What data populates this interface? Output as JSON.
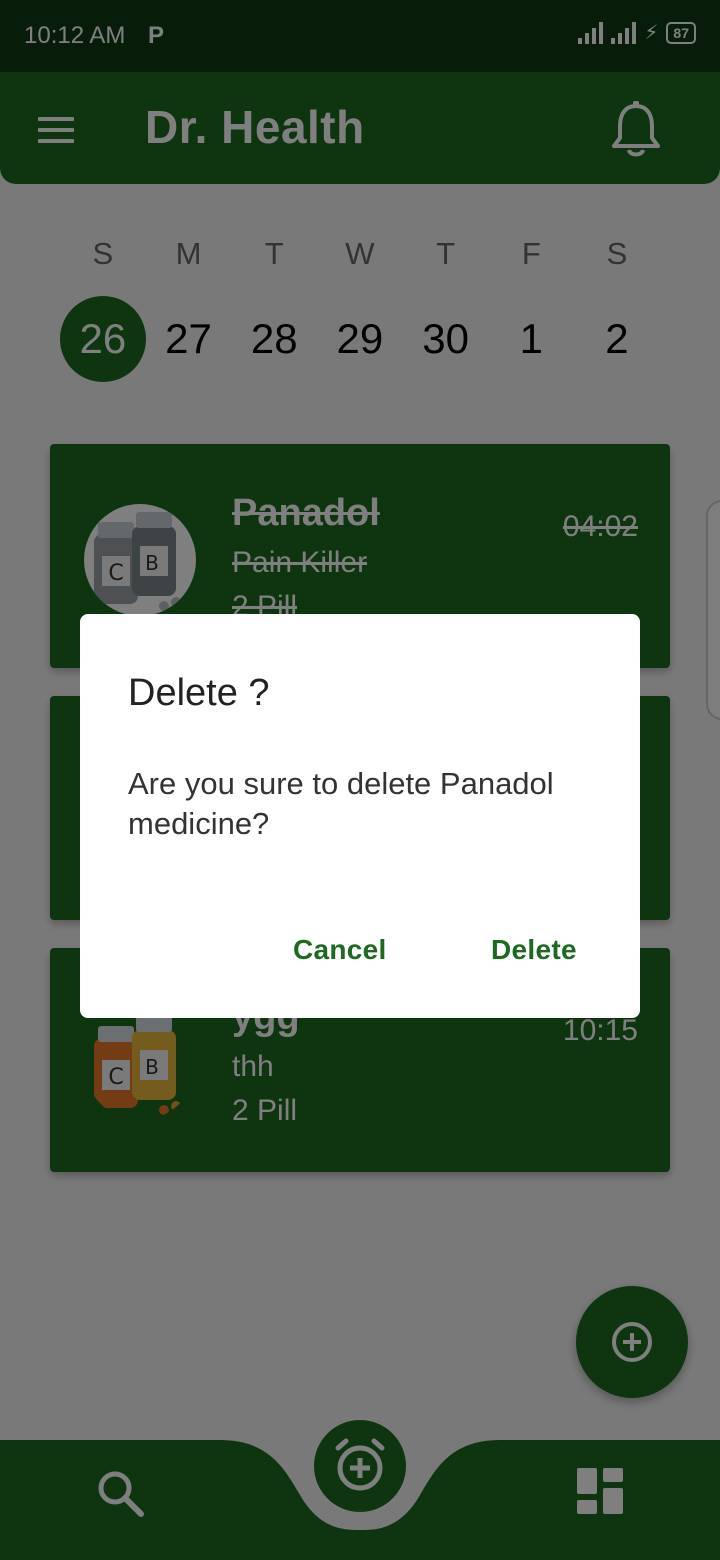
{
  "status": {
    "time": "10:12 AM",
    "p_icon": "P",
    "battery": "87"
  },
  "app": {
    "title": "Dr. Health",
    "menu_icon": "hamburger-menu-icon",
    "bell_icon": "bell-icon"
  },
  "calendar": {
    "weekdays": [
      "S",
      "M",
      "T",
      "W",
      "T",
      "F",
      "S"
    ],
    "dates": [
      "26",
      "27",
      "28",
      "29",
      "30",
      "1",
      "2"
    ],
    "selected_index": 0
  },
  "medicines": [
    {
      "name": "Panadol",
      "type": "Pain Killer",
      "dose": "2 Pill",
      "time": "04:02",
      "taken": true
    },
    {
      "name": "",
      "type": "",
      "dose": "",
      "time": ""
    },
    {
      "name": "ygg",
      "type": "thh",
      "dose": "2 Pill",
      "time": "10:15",
      "taken": false
    }
  ],
  "dialog": {
    "title": "Delete ?",
    "message": "Are you sure to delete Panadol medicine?",
    "cancel": "Cancel",
    "delete": "Delete"
  },
  "nav": {
    "left_icon": "search-icon",
    "center_icon": "alarm-add-icon",
    "right_icon": "dashboard-icon",
    "fab_icon": "add-circle-icon"
  },
  "colors": {
    "primary": "#1c6a20",
    "status_bar": "#0f3b12"
  }
}
